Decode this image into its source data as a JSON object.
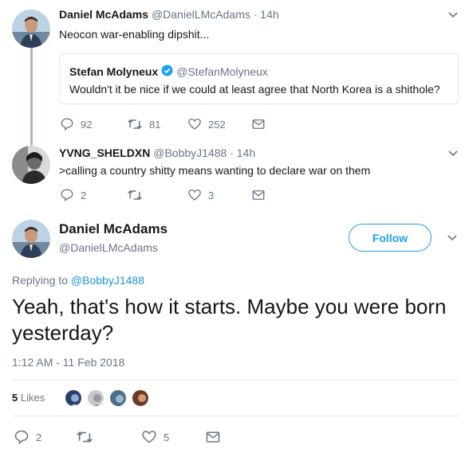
{
  "tweets": [
    {
      "name": "Daniel McAdams",
      "handle": "@DanielLMcAdams",
      "time": "· 14h",
      "text": "Neocon war-enabling dipshit...",
      "quote": {
        "name": "Stefan Molyneux",
        "handle": "@StefanMolyneux",
        "text": "Wouldn't it be nice if we could at least agree that North Korea is a shithole?"
      },
      "replies": "92",
      "retweets": "81",
      "likes": "252"
    },
    {
      "name": "YVNG_SHELDXN",
      "handle": "@BobbyJ1488",
      "time": "· 14h",
      "text": ">calling a country shitty means wanting to declare war on them",
      "replies": "2",
      "retweets": "",
      "likes": "3"
    }
  ],
  "main": {
    "name": "Daniel McAdams",
    "handle": "@DanielLMcAdams",
    "follow_label": "Follow",
    "replying_prefix": "Replying to",
    "replying_to": "@BobbyJ1488",
    "text": "Yeah, that's how it starts. Maybe you were born yesterday?",
    "timestamp": "1:12 AM - 11 Feb 2018",
    "likes_count": "5",
    "likes_label": "Likes",
    "replies": "2",
    "retweets": "",
    "likes": "5"
  },
  "colors": {
    "accent": "#1da1f2",
    "link": "#1b95e0",
    "muted": "#657786",
    "verified": "#1da1f2"
  },
  "icons": {
    "reply": "reply-icon",
    "retweet": "retweet-icon",
    "like": "heart-icon",
    "message": "envelope-icon",
    "caret": "chevron-down-icon",
    "verified": "verified-badge-icon"
  }
}
